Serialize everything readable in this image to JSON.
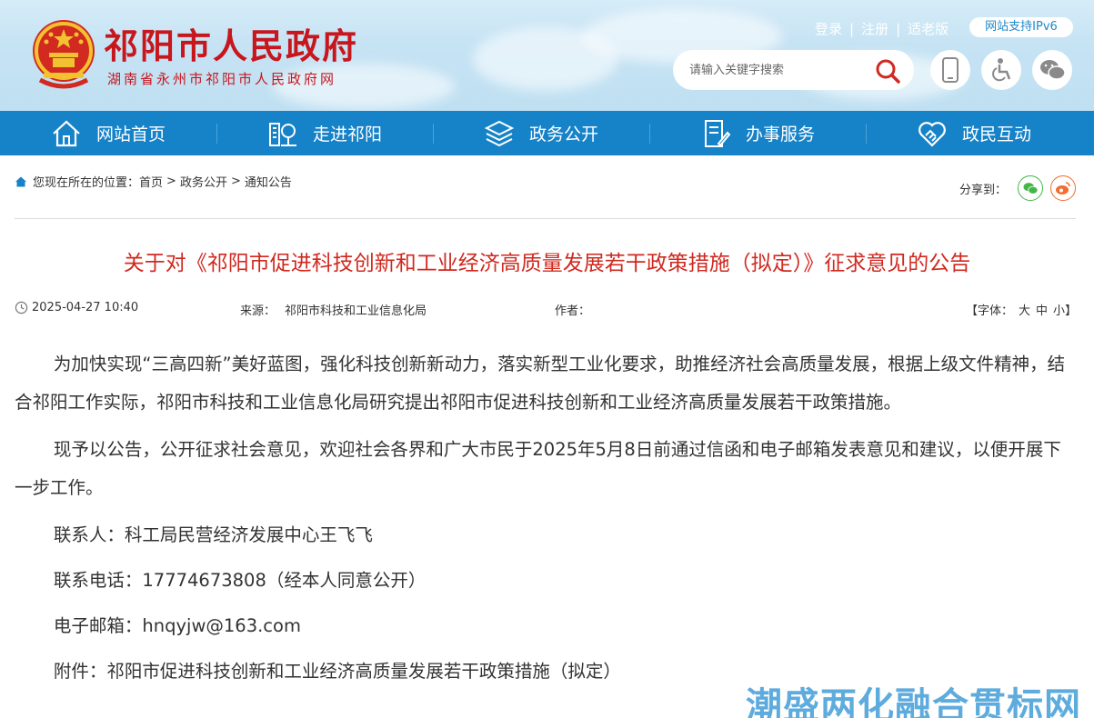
{
  "header": {
    "site_title": "祁阳市人民政府",
    "site_subtitle": "湖南省永州市祁阳市人民政府网",
    "links": [
      "登录",
      "注册",
      "适老版"
    ],
    "ipv6_badge": "网站支持IPv6",
    "search": {
      "placeholder": "请输入关键字搜索",
      "icon": "search-icon"
    },
    "icon_buttons": [
      "mobile-icon",
      "accessibility-icon",
      "wechat-icon"
    ]
  },
  "nav": {
    "items": [
      {
        "label": "网站首页",
        "icon": "home-icon"
      },
      {
        "label": "走进祁阳",
        "icon": "city-icon"
      },
      {
        "label": "政务公开",
        "icon": "layers-icon"
      },
      {
        "label": "办事服务",
        "icon": "document-icon"
      },
      {
        "label": "政民互动",
        "icon": "heart-handshake-icon"
      }
    ]
  },
  "breadcrumb": {
    "prefix": "您现在所在的位置：",
    "items": [
      "首页",
      "政务公开",
      "通知公告"
    ],
    "separator": ">"
  },
  "share": {
    "label": "分享到：",
    "targets": [
      "wechat",
      "weibo"
    ]
  },
  "article": {
    "title": "关于对《祁阳市促进科技创新和工业经济高质量发展若干政策措施（拟定）》征求意见的公告",
    "date": "2025-04-27 10:40",
    "source_label": "来源：",
    "source": "祁阳市科技和工业信息化局",
    "author_label": "作者：",
    "author": "",
    "font_label": "【字体：",
    "font_sizes": [
      "大",
      "中",
      "小"
    ],
    "font_close": "】",
    "paragraphs": [
      "为加快实现“三高四新”美好蓝图，强化科技创新新动力，落实新型工业化要求，助推经济社会高质量发展，根据上级文件精神，结合祁阳工作实际，祁阳市科技和工业信息化局研究提出祁阳市促进科技创新和工业经济高质量发展若干政策措施。",
      "现予以公告，公开征求社会意见，欢迎社会各界和广大市民于2025年5月8日前通过信函和电子邮箱发表意见和建议，以便开展下一步工作。",
      "联系人：科工局民营经济发展中心王飞飞",
      "联系电话：17774673808（经本人同意公开）",
      "电子邮箱：hnqyjw@163.com",
      "附件：祁阳市促进科技创新和工业经济高质量发展若干政策措施（拟定）"
    ]
  },
  "watermark": "潮盛两化融合贯标网",
  "colors": {
    "brand_red": "#c8161d",
    "nav_blue": "#1682c8",
    "title_red": "#d0291f",
    "wechat_green": "#44b549",
    "weibo_orange": "#f26d2f"
  }
}
